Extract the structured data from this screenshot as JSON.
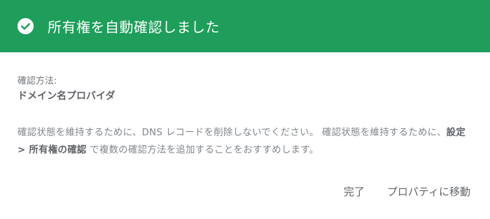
{
  "header": {
    "title": "所有権を自動確認しました",
    "icon": "check-circle-icon",
    "background_color": "#1e9e5a"
  },
  "method": {
    "label": "確認方法:",
    "value": "ドメイン名プロバイダ"
  },
  "note": {
    "text_before": "確認状態を維持するために、DNS レコードを削除しないでください。 確認状態を維持するために、",
    "emphasis": "設定 > 所有権の確認",
    "text_after": " で複数の確認方法を追加することをおすすめします。"
  },
  "actions": {
    "done_label": "完了",
    "go_to_property_label": "プロパティに移動"
  }
}
